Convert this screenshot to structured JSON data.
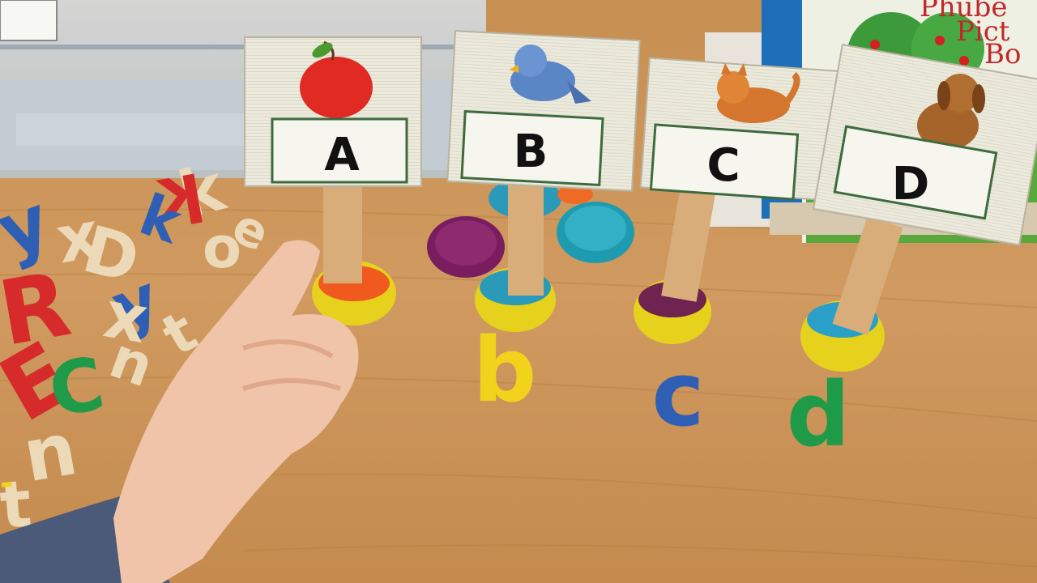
{
  "scene": {
    "description_name": "alphabet-sorting-activity",
    "signs": [
      {
        "letter": "A",
        "picture": "apple",
        "dough_color": "#f05a1e"
      },
      {
        "letter": "B",
        "picture": "bird",
        "dough_color": "#2a9ab8"
      },
      {
        "letter": "C",
        "picture": "cat",
        "dough_color": "#6e2350"
      },
      {
        "letter": "D",
        "picture": "dog",
        "dough_color": "#2aa0c8"
      }
    ],
    "lowercase": [
      {
        "letter": "b",
        "color": "#f2d31c"
      },
      {
        "letter": "c",
        "color": "#2f5fb5"
      },
      {
        "letter": "d",
        "color": "#1f9a48"
      }
    ],
    "book": {
      "line1": "Phube",
      "line2": "Pict",
      "line3": "Bo"
    },
    "colors": {
      "table": "#c9955a",
      "table_grain": "#b98247",
      "card": "#eceadd",
      "card_border": "#3d6b3d",
      "stick": "#d9ad7a",
      "tub": "#e6d21c",
      "wood_letter": "#ecd9b8",
      "skin": "#f0c4a8",
      "sleeve": "#4a5a78"
    }
  }
}
